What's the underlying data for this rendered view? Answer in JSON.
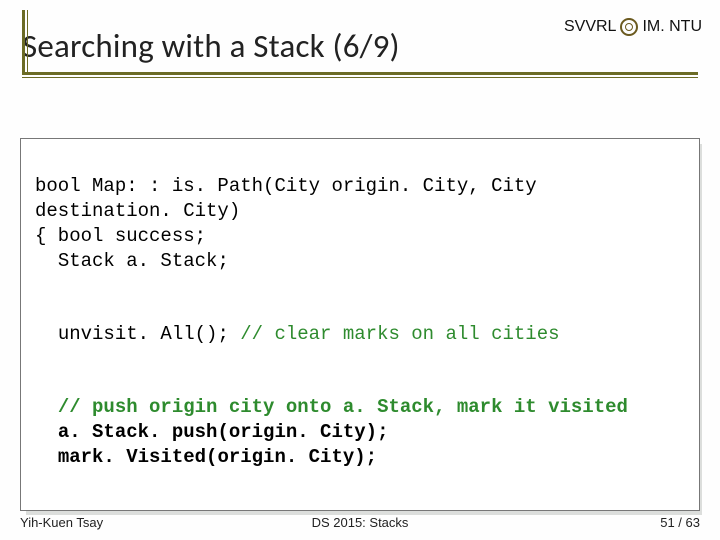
{
  "header": {
    "title": "Searching with a Stack (6/9)",
    "affil_left": "SVVRL",
    "affil_right": "IM. NTU"
  },
  "code": {
    "l0": "bool Map: : is. Path(City origin. City, City",
    "l1": "destination. City)",
    "l2": "{ bool success;",
    "l3": "  Stack a. Stack;",
    "l4": "  unvisit. All();",
    "l4c": " // clear marks on all cities",
    "l5c_a": "  // push origin city onto a. Stack, mark it visited",
    "l6": "  a. Stack. push(origin. City);",
    "l7": "  mark. Visited(origin. City);"
  },
  "footer": {
    "left": "Yih-Kuen Tsay",
    "center": "DS 2015: Stacks",
    "page_current": "51",
    "page_sep": " / ",
    "page_total": "63"
  }
}
